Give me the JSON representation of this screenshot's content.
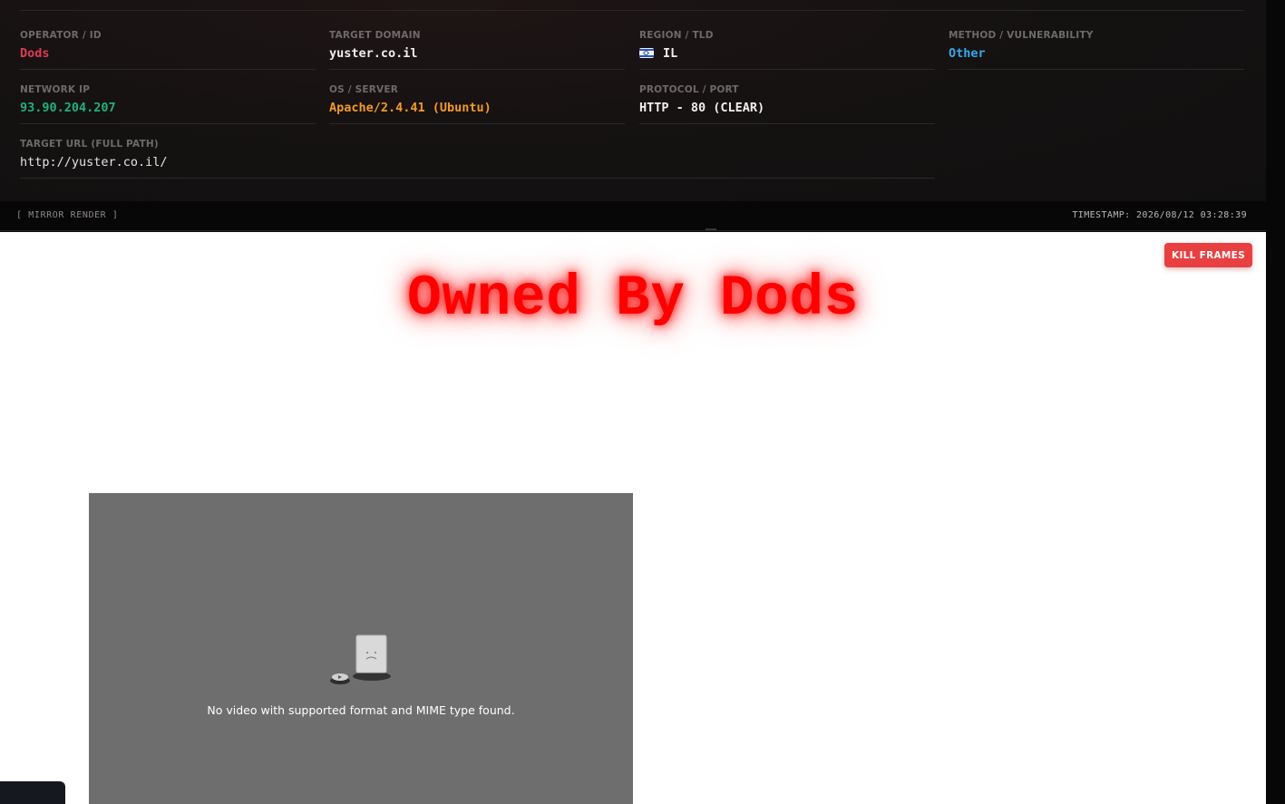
{
  "info": {
    "operator_label": "OPERATOR / ID",
    "operator_value": "Dods",
    "domain_label": "TARGET DOMAIN",
    "domain_value": "yuster.co.il",
    "region_label": "REGION / TLD",
    "region_value": "IL",
    "method_label": "METHOD / VULNERABILITY",
    "method_value": "Other",
    "ip_label": "NETWORK IP",
    "ip_value": "93.90.204.207",
    "os_label": "OS / SERVER",
    "os_value": "Apache/2.4.41 (Ubuntu)",
    "protocol_label": "PROTOCOL / PORT",
    "protocol_value": "HTTP - 80 (CLEAR)",
    "url_label": "TARGET URL (FULL PATH)",
    "url_value": "http://yuster.co.il/"
  },
  "bar": {
    "left_text": "[ MIRROR RENDER ]",
    "timestamp": "TIMESTAMP: 2026/08/12 03:28:39"
  },
  "mirror": {
    "kill_button": "KILL FRAMES",
    "headline": "Owned By Dods",
    "video_message": "No video with supported format and MIME type found."
  },
  "colors": {
    "operator": "#e03a52",
    "method": "#38a9e8",
    "ip": "#22b07a",
    "os": "#f2992a",
    "headline": "#ff0000",
    "kill_button": "#e84040"
  },
  "icons": {
    "flag": "israel-flag-icon",
    "video_error": "broken-plugin-icon"
  }
}
